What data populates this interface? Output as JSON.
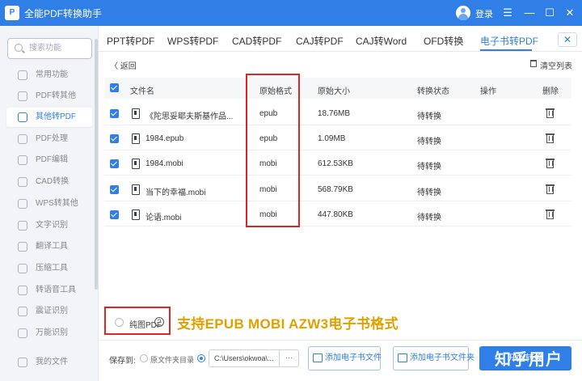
{
  "app": {
    "title": "全能PDF转换助手",
    "logo_text": "P",
    "login": "登录"
  },
  "window_controls": {
    "menu": "☰",
    "minimize": "—",
    "maximize": "☐",
    "close": "✕"
  },
  "search": {
    "placeholder": "搜索功能"
  },
  "sidebar": {
    "items": [
      {
        "label": "常用功能"
      },
      {
        "label": "PDF转其他"
      },
      {
        "label": "其他转PDF"
      },
      {
        "label": "PDF处理"
      },
      {
        "label": "PDF编辑"
      },
      {
        "label": "CAD转换"
      },
      {
        "label": "WPS转其他"
      },
      {
        "label": "文字识别"
      },
      {
        "label": "翻译工具"
      },
      {
        "label": "压缩工具"
      },
      {
        "label": "转语音工具"
      },
      {
        "label": "震证识别"
      },
      {
        "label": "万能识别"
      },
      {
        "label": "我的文件"
      }
    ]
  },
  "tabs": [
    {
      "label": "PPT转PDF"
    },
    {
      "label": "WPS转PDF"
    },
    {
      "label": "CAD转PDF"
    },
    {
      "label": "CAJ转PDF"
    },
    {
      "label": "CAJ转Word"
    },
    {
      "label": "OFD转换"
    },
    {
      "label": "电子书转PDF"
    }
  ],
  "tab_close": "✕",
  "toolbar": {
    "back": "〈 返回",
    "clear": "清空列表"
  },
  "table": {
    "headers": {
      "name": "文件名",
      "format": "原始格式",
      "size": "原始大小",
      "status": "转换状态",
      "action": "操作",
      "delete": "删除"
    },
    "rows": [
      {
        "name": "《陀思妥耶夫斯基作品...",
        "format": "epub",
        "size": "18.76MB",
        "status": "待转换"
      },
      {
        "name": "1984.epub",
        "format": "epub",
        "size": "1.09MB",
        "status": "待转换"
      },
      {
        "name": "1984.mobi",
        "format": "mobi",
        "size": "612.53KB",
        "status": "待转换"
      },
      {
        "name": "当下的幸福.mobi",
        "format": "mobi",
        "size": "568.79KB",
        "status": "待转换"
      },
      {
        "name": "论语.mobi",
        "format": "mobi",
        "size": "447.80KB",
        "status": "待转换"
      }
    ]
  },
  "pure_pdf": {
    "label": "纯图PDF",
    "help": "?"
  },
  "annotation": "支持EPUB MOBI AZW3电子书格式",
  "bottom": {
    "save_to": "保存到:",
    "source_dir": "原文件夹目录",
    "path": "C:\\Users\\okwoa\\...",
    "more": "···",
    "add_file": "添加电子书文件",
    "add_folder": "添加电子书文件夹",
    "start": "开始转换"
  },
  "watermark": "知乎用户"
}
